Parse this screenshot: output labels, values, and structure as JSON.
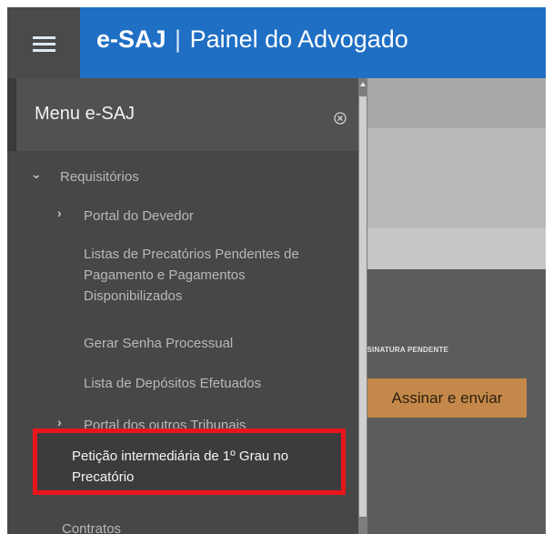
{
  "header": {
    "brand": "e-SAJ",
    "separator": "|",
    "subtitle": "Painel do Advogado",
    "accent_color": "#1f6fc4"
  },
  "menu": {
    "title": "Menu e-SAJ",
    "close_icon": "close-circle-icon",
    "items": [
      {
        "label": "Requisitórios",
        "expander": "chevron-down-icon"
      },
      {
        "label": "Portal do Devedor",
        "expander": "chevron-right-icon"
      },
      {
        "label": "Listas de Precatórios Pendentes de Pagamento e Pagamentos Disponibilizados"
      },
      {
        "label": "Gerar Senha Processual"
      },
      {
        "label": "Lista de Depósitos Efetuados"
      },
      {
        "label": "Portal dos outros Tribunais",
        "expander": "chevron-right-icon"
      },
      {
        "label": "Petição intermediária de 1º Grau no Precatório",
        "highlighted": true
      },
      {
        "label": "Contratos"
      }
    ]
  },
  "content": {
    "pending_label": "ASSINATURA PENDENTE",
    "sign_button": "Assinar e enviar",
    "button_color": "#c4894a"
  }
}
